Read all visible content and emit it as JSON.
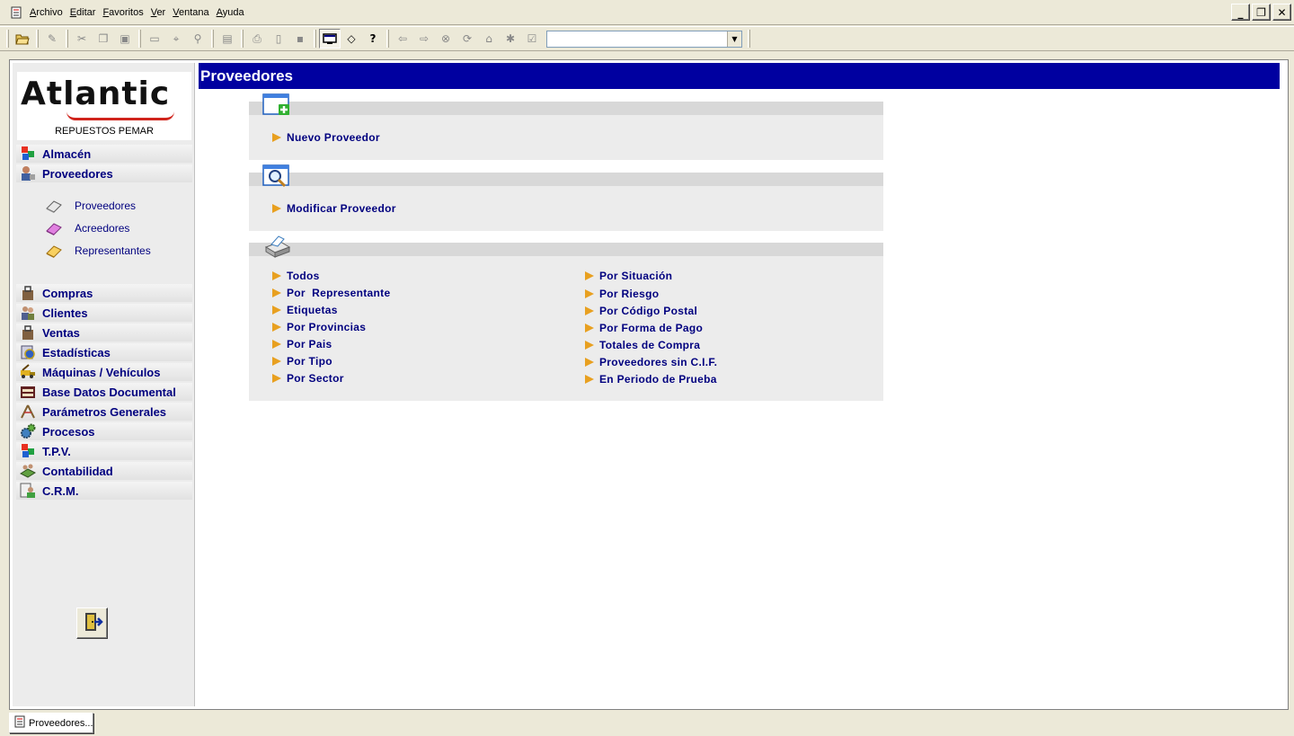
{
  "menubar": {
    "items": [
      "Archivo",
      "Editar",
      "Favoritos",
      "Ver",
      "Ventana",
      "Ayuda"
    ],
    "window_controls": [
      "_",
      "❐",
      "✕"
    ]
  },
  "toolbar": {
    "address_value": ""
  },
  "sidebar": {
    "logo": "Atlantic",
    "company": "REPUESTOS PEMAR",
    "nav_top": [
      {
        "label": "Almacén",
        "icon": "cubes-icon"
      },
      {
        "label": "Proveedores",
        "icon": "supplier-icon"
      }
    ],
    "sub_items": [
      {
        "label": "Proveedores",
        "icon": "book-icon"
      },
      {
        "label": "Acreedores",
        "icon": "book-icon"
      },
      {
        "label": "Representantes",
        "icon": "book-icon"
      }
    ],
    "nav_bottom": [
      {
        "label": "Compras",
        "icon": "bag-icon"
      },
      {
        "label": "Clientes",
        "icon": "users-icon"
      },
      {
        "label": "Ventas",
        "icon": "bag-icon"
      },
      {
        "label": "Estadísticas",
        "icon": "chart-icon"
      },
      {
        "label": "Máquinas / Vehículos",
        "icon": "truck-icon"
      },
      {
        "label": "Base Datos Documental",
        "icon": "archive-icon"
      },
      {
        "label": "Parámetros Generales",
        "icon": "compass-icon"
      },
      {
        "label": "Procesos",
        "icon": "gears-icon"
      },
      {
        "label": "T.P.V.",
        "icon": "cubes-icon"
      },
      {
        "label": "Contabilidad",
        "icon": "ledger-icon"
      },
      {
        "label": "C.R.M.",
        "icon": "crm-icon"
      }
    ]
  },
  "main": {
    "title": "Proveedores",
    "panel_new": {
      "link": "Nuevo Proveedor"
    },
    "panel_modify": {
      "link": "Modificar Proveedor"
    },
    "panel_print": {
      "left": [
        "Todos",
        "Por  Representante",
        "Etiquetas",
        "Por Provincias",
        "Por Pais",
        "Por Tipo",
        "Por Sector"
      ],
      "right": [
        "Por Situación",
        "Por Riesgo",
        "Por Código Postal",
        "Por Forma de Pago",
        "Totales de Compra",
        "Proveedores sin C.I.F.",
        "En Periodo de Prueba"
      ]
    }
  },
  "taskbar": {
    "tab_label": "Proveedores..."
  },
  "colors": {
    "title_bg": "#0000a0",
    "link": "#00007f",
    "arrow": "#e8a020",
    "panel": "#ececec"
  }
}
